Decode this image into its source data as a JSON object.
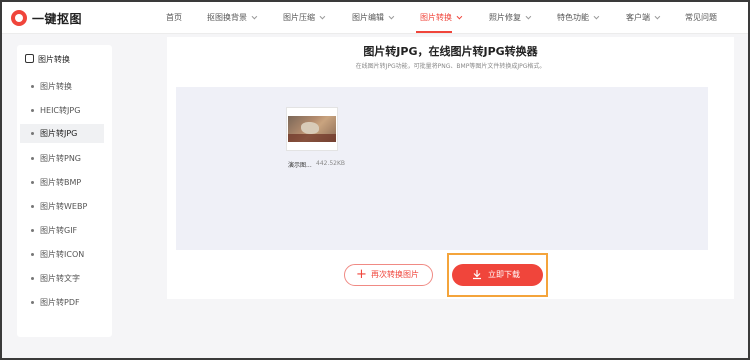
{
  "header": {
    "brand": "一键抠图",
    "nav": [
      {
        "label": "首页",
        "dropdown": false
      },
      {
        "label": "抠图换背景",
        "dropdown": true
      },
      {
        "label": "图片压缩",
        "dropdown": true
      },
      {
        "label": "图片编辑",
        "dropdown": true
      },
      {
        "label": "图片转换",
        "dropdown": true,
        "active": true
      },
      {
        "label": "照片修复",
        "dropdown": true
      },
      {
        "label": "特色功能",
        "dropdown": true
      },
      {
        "label": "客户端",
        "dropdown": true
      },
      {
        "label": "常见问题",
        "dropdown": false
      }
    ]
  },
  "sidebar": {
    "heading": "图片转换",
    "items": [
      {
        "label": "图片转换"
      },
      {
        "label": "HEIC转JPG"
      },
      {
        "label": "图片转JPG",
        "active": true
      },
      {
        "label": "图片转PNG"
      },
      {
        "label": "图片转BMP"
      },
      {
        "label": "图片转WEBP"
      },
      {
        "label": "图片转GIF"
      },
      {
        "label": "图片转ICON"
      },
      {
        "label": "图片转文字"
      },
      {
        "label": "图片转PDF"
      }
    ]
  },
  "main": {
    "title": "图片转JPG，在线图片转JPG转换器",
    "subtitle": "在线图片转JPG功能，可批量将PNG、BMP等图片文件转换成JPG格式。",
    "file": {
      "name": "演示图...",
      "size": "442.52KB"
    },
    "again_button": "再次转换图片",
    "download_button": "立即下载"
  },
  "colors": {
    "accent": "#f0453b",
    "highlight": "#f4a43b",
    "dropzone": "#eff0f7"
  }
}
